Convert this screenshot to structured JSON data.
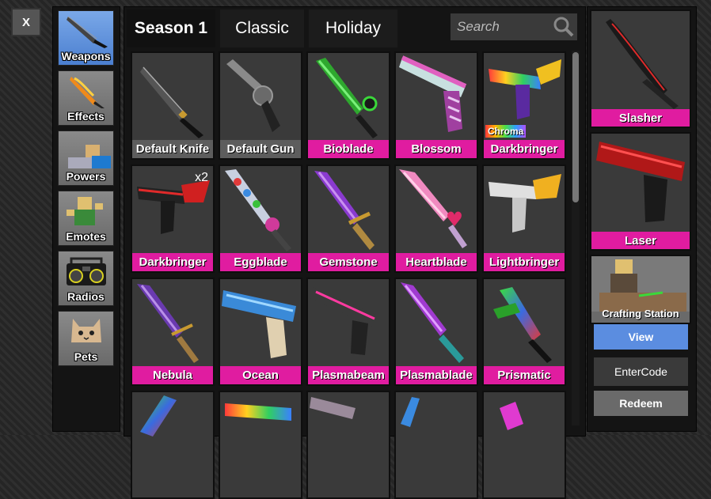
{
  "close_label": "X",
  "categories": [
    {
      "label": "Weapons",
      "icon": "knife-icon",
      "active": true
    },
    {
      "label": "Effects",
      "icon": "fire-knife-icon",
      "active": false
    },
    {
      "label": "Powers",
      "icon": "powers-icon",
      "active": false
    },
    {
      "label": "Emotes",
      "icon": "emote-figure-icon",
      "active": false
    },
    {
      "label": "Radios",
      "icon": "boombox-icon",
      "active": false
    },
    {
      "label": "Pets",
      "icon": "cat-pet-icon",
      "active": false
    }
  ],
  "tabs": [
    {
      "label": "Season 1",
      "active": true
    },
    {
      "label": "Classic",
      "active": false
    },
    {
      "label": "Holiday",
      "active": false
    }
  ],
  "search": {
    "placeholder": "Search"
  },
  "items": [
    {
      "name": "Default Knife",
      "icon": "knife-icon",
      "style": "gray"
    },
    {
      "name": "Default Gun",
      "icon": "revolver-icon",
      "style": "gray"
    },
    {
      "name": "Bioblade",
      "icon": "bioblade-icon",
      "style": "pink"
    },
    {
      "name": "Blossom",
      "icon": "blossom-gun-icon",
      "style": "pink"
    },
    {
      "name": "Darkbringer",
      "icon": "chroma-gun-icon",
      "style": "pink",
      "badge": "Chroma"
    },
    {
      "name": "Darkbringer",
      "icon": "darkbringer-gun-icon",
      "style": "pink",
      "count": "x2"
    },
    {
      "name": "Eggblade",
      "icon": "eggblade-icon",
      "style": "pink"
    },
    {
      "name": "Gemstone",
      "icon": "gemstone-sword-icon",
      "style": "pink"
    },
    {
      "name": "Heartblade",
      "icon": "heartblade-icon",
      "style": "pink"
    },
    {
      "name": "Lightbringer",
      "icon": "lightbringer-gun-icon",
      "style": "pink"
    },
    {
      "name": "Nebula",
      "icon": "nebula-sword-icon",
      "style": "pink"
    },
    {
      "name": "Ocean",
      "icon": "ocean-gun-icon",
      "style": "pink"
    },
    {
      "name": "Plasmabeam",
      "icon": "plasmabeam-gun-icon",
      "style": "pink"
    },
    {
      "name": "Plasmablade",
      "icon": "plasmablade-icon",
      "style": "pink"
    },
    {
      "name": "Prismatic",
      "icon": "prismatic-blade-icon",
      "style": "pink"
    }
  ],
  "equipped": {
    "knife": {
      "name": "Slasher",
      "icon": "slasher-knife-icon"
    },
    "gun": {
      "name": "Laser",
      "icon": "laser-gun-icon"
    }
  },
  "crafting": {
    "label": "Crafting Station",
    "view_label": "View"
  },
  "code": {
    "enter_label": "EnterCode",
    "redeem_label": "Redeem"
  },
  "colors": {
    "pink": "#e01ca0",
    "gray": "#5d5d5d",
    "blue": "#5b8de0"
  }
}
